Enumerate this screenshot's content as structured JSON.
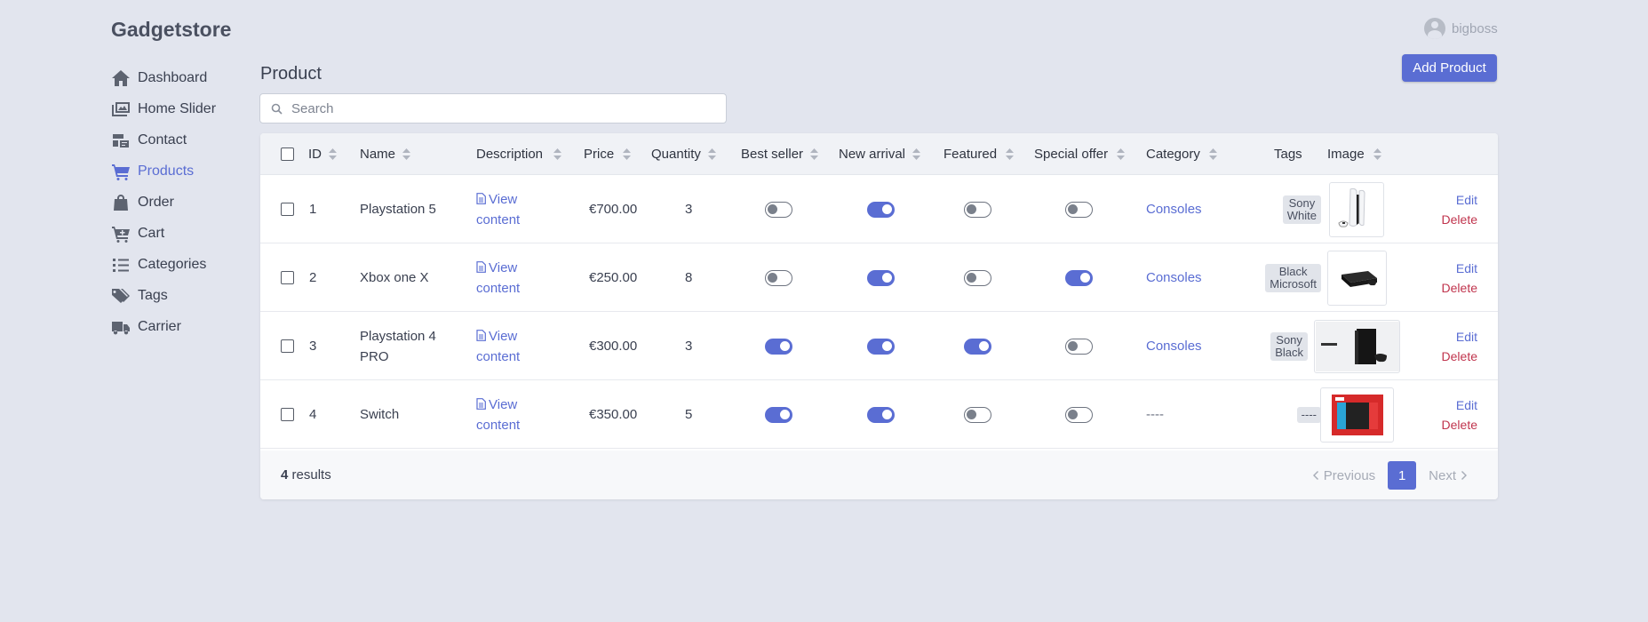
{
  "app": {
    "brand": "Gadgetstore",
    "user": "bigboss"
  },
  "sidebar": {
    "items": [
      {
        "label": "Dashboard",
        "icon": "home-icon"
      },
      {
        "label": "Home Slider",
        "icon": "images-icon"
      },
      {
        "label": "Contact",
        "icon": "contact-icon"
      },
      {
        "label": "Products",
        "icon": "cart-icon",
        "active": true
      },
      {
        "label": "Order",
        "icon": "bag-icon"
      },
      {
        "label": "Cart",
        "icon": "cart-plus-icon"
      },
      {
        "label": "Categories",
        "icon": "list-icon"
      },
      {
        "label": "Tags",
        "icon": "tags-icon"
      },
      {
        "label": "Carrier",
        "icon": "truck-icon"
      }
    ]
  },
  "main": {
    "title": "Product",
    "add_label": "Add Product",
    "search": {
      "placeholder": "Search",
      "value": ""
    }
  },
  "table": {
    "headers": {
      "id": "ID",
      "name": "Name",
      "description": "Description",
      "price": "Price",
      "quantity": "Quantity",
      "best_seller": "Best seller",
      "new_arrival": "New arrival",
      "featured": "Featured",
      "special_offer": "Special offer",
      "category": "Category",
      "tags": "Tags",
      "image": "Image"
    },
    "rows": [
      {
        "id": "1",
        "name_l1": "Playstation 5",
        "name_l2": "",
        "desc_l1": "View",
        "desc_l2": "content",
        "price": "€700.00",
        "quantity": "3",
        "best_seller": false,
        "new_arrival": true,
        "featured": false,
        "special_offer": false,
        "category": "Consoles",
        "tag_l1": "Sony",
        "tag_l2": "White",
        "image": "ps5-image",
        "edit": "Edit",
        "delete": "Delete"
      },
      {
        "id": "2",
        "name_l1": "Xbox one X",
        "name_l2": "",
        "desc_l1": "View",
        "desc_l2": "content",
        "price": "€250.00",
        "quantity": "8",
        "best_seller": false,
        "new_arrival": true,
        "featured": false,
        "special_offer": true,
        "category": "Consoles",
        "tag_l1": "Black",
        "tag_l2": "Microsoft",
        "image": "xbox-image",
        "edit": "Edit",
        "delete": "Delete"
      },
      {
        "id": "3",
        "name_l1": "Playstation 4",
        "name_l2": "PRO",
        "desc_l1": "View",
        "desc_l2": "content",
        "price": "€300.00",
        "quantity": "3",
        "best_seller": true,
        "new_arrival": true,
        "featured": true,
        "special_offer": false,
        "category": "Consoles",
        "tag_l1": "Sony",
        "tag_l2": "Black",
        "image": "ps4-pro-image",
        "edit": "Edit",
        "delete": "Delete"
      },
      {
        "id": "4",
        "name_l1": "Switch",
        "name_l2": "",
        "desc_l1": "View",
        "desc_l2": "content",
        "price": "€350.00",
        "quantity": "5",
        "best_seller": true,
        "new_arrival": true,
        "featured": false,
        "special_offer": false,
        "category": "----",
        "tag_l1": "----",
        "tag_l2": "",
        "image": "switch-image",
        "edit": "Edit",
        "delete": "Delete"
      }
    ]
  },
  "footer": {
    "results_count": "4",
    "results_label": "results",
    "prev_label": "Previous",
    "next_label": "Next",
    "current_page": "1"
  },
  "colors": {
    "accent": "#5a6dd3",
    "danger": "#c0344d",
    "background": "#e2e5ee"
  }
}
